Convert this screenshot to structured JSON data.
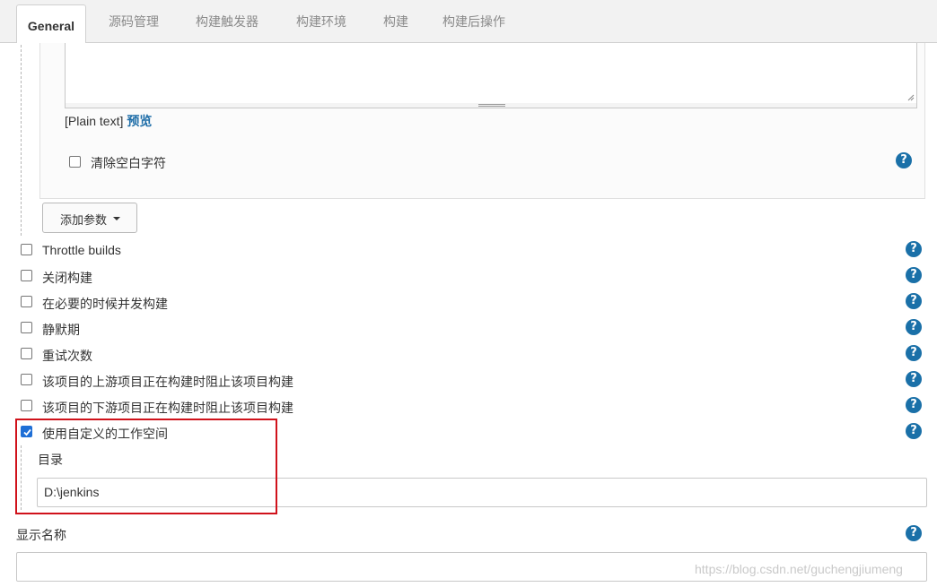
{
  "tabs": [
    {
      "label": "General",
      "active": true
    },
    {
      "label": "源码管理"
    },
    {
      "label": "构建触发器"
    },
    {
      "label": "构建环境"
    },
    {
      "label": "构建"
    },
    {
      "label": "构建后操作"
    }
  ],
  "param": {
    "textarea_value": "",
    "plain_text": "[Plain text]",
    "preview": "预览",
    "trim_label": "清除空白字符",
    "trim_checked": false
  },
  "add_param_button": "添加参数",
  "options": [
    {
      "label": "Throttle builds",
      "checked": false
    },
    {
      "label": "关闭构建",
      "checked": false
    },
    {
      "label": "在必要的时候并发构建",
      "checked": false
    },
    {
      "label": "静默期",
      "checked": false
    },
    {
      "label": "重试次数",
      "checked": false
    },
    {
      "label": "该项目的上游项目正在构建时阻止该项目构建",
      "checked": false
    },
    {
      "label": "该项目的下游项目正在构建时阻止该项目构建",
      "checked": false
    },
    {
      "label": "使用自定义的工作空间",
      "checked": true
    }
  ],
  "workspace": {
    "dir_label": "目录",
    "dir_value": "D:\\jenkins"
  },
  "display_name": {
    "label": "显示名称",
    "value": ""
  },
  "help_glyph": "?",
  "watermark": "https://blog.csdn.net/guchengjiumeng",
  "colors": {
    "help_icon": "#1a70a8",
    "link": "#1f6ea8",
    "checkbox_checked": "#1f6fd6",
    "highlight_box": "#d0121b"
  }
}
